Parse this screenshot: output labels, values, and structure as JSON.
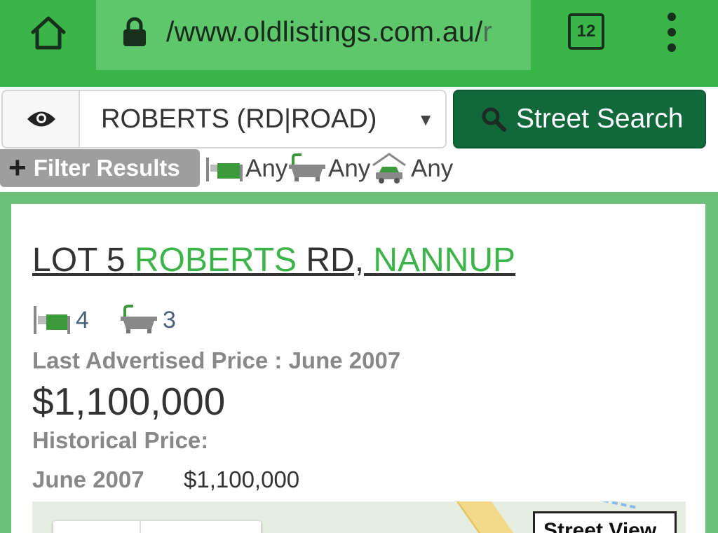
{
  "browser": {
    "url_main": "/www.oldlistings.com.au/",
    "url_tail": "r",
    "tab_count": "12",
    "icons": [
      "home-icon",
      "lock-icon",
      "tabs-icon",
      "more-vert-icon"
    ]
  },
  "search": {
    "street_value": "ROBERTS (RD|ROAD)",
    "caret": "▼",
    "button_label": "Street Search",
    "icons": [
      "eye-icon",
      "search-icon"
    ]
  },
  "filters": {
    "label": "Filter Results",
    "beds": "Any",
    "baths": "Any",
    "cars": "Any",
    "icons": [
      "plus-icon",
      "bed-icon",
      "bath-icon",
      "car-icon"
    ]
  },
  "listing": {
    "title_lot": "LOT 5 ",
    "title_street": "ROBERTS",
    "title_type": " RD, ",
    "title_suburb": "NANNUP",
    "beds": "4",
    "baths": "3",
    "last_advertised": "Last Advertised Price : June 2007",
    "price": "$1,100,000",
    "historical_label": "Historical Price:",
    "history": [
      {
        "date": "June 2007",
        "price": "$1,100,000"
      }
    ]
  },
  "map": {
    "street_view_label": "Street View"
  },
  "colors": {
    "brand_green": "#3bb54a",
    "dark_green": "#11683a",
    "link_green": "#3cb44a"
  }
}
